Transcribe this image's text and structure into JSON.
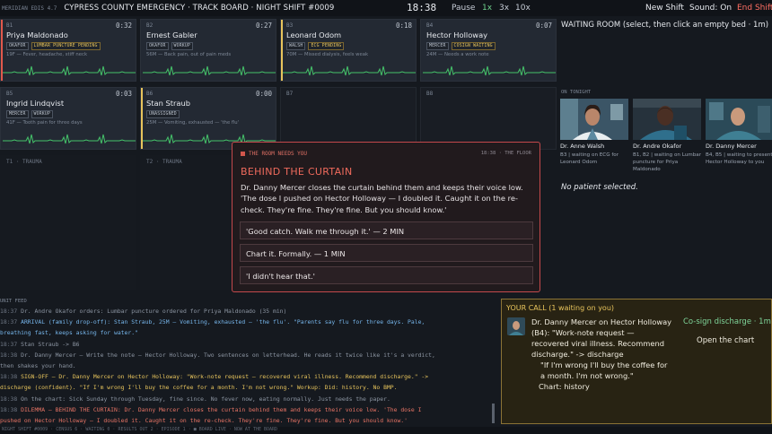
{
  "topbar": {
    "brand": "MERIDIAN EDIS 4.7",
    "hospital": "CYPRESS COUNTY EMERGENCY · TRACK BOARD · NIGHT SHIFT #0009",
    "clock": "18:38",
    "pause_label": "Pause",
    "speeds": [
      "1x",
      "3x",
      "10x"
    ],
    "new_shift_label": "New Shift",
    "sound_label": "Sound: On",
    "end_shift_label": "End Shift"
  },
  "beds": [
    {
      "id": "B1",
      "timer": "0:32",
      "name": "Priya Maldonado",
      "tags": [
        "OKAFOR",
        "LUMBAR PUNCTURE PENDING"
      ],
      "tag_warn": [
        false,
        true
      ],
      "cc": "19F — Fever, headache, stiff neck",
      "accent": "#e0584c"
    },
    {
      "id": "B2",
      "timer": "0:27",
      "name": "Ernest Gabler",
      "tags": [
        "OKAFOR",
        "WORKUP"
      ],
      "tag_warn": [
        false,
        false
      ],
      "cc": "56M — Back pain, out of pain meds",
      "accent": ""
    },
    {
      "id": "B3",
      "timer": "0:18",
      "name": "Leonard Odom",
      "tags": [
        "WALSH",
        "ECG PENDING"
      ],
      "tag_warn": [
        false,
        true
      ],
      "cc": "70M — Missed dialysis, feels weak",
      "accent": "#e8c45c"
    },
    {
      "id": "B4",
      "timer": "0:07",
      "name": "Hector Holloway",
      "tags": [
        "MERCER",
        "COSIGN WAITING"
      ],
      "tag_warn": [
        false,
        true
      ],
      "cc": "24M — Needs a work note",
      "accent": ""
    },
    {
      "id": "B5",
      "timer": "0:03",
      "name": "Ingrid Lindqvist",
      "tags": [
        "MERCER",
        "WORKUP"
      ],
      "tag_warn": [
        false,
        false
      ],
      "cc": "41F — Tooth pain for three days",
      "accent": ""
    },
    {
      "id": "B6",
      "timer": "0:00",
      "name": "Stan Straub",
      "tags": [
        "UNASSIGNED"
      ],
      "tag_warn": [
        false
      ],
      "cc": "25M — Vomiting, exhausted — 'the flu'",
      "accent": "#e8c45c"
    }
  ],
  "empty_beds": [
    "B7",
    "B8"
  ],
  "trauma_bays": [
    "T1 · TRAUMA",
    "T2 · TRAUMA"
  ],
  "waiting": {
    "title": "WAITING ROOM  (select, then click an empty bed · 1m)",
    "on_tonight_label": "ON TONIGHT",
    "no_patient": "No patient selected."
  },
  "doctors": [
    {
      "name": "Dr. Anne Walsh",
      "note": "B3 | waiting on ECG for Leonard Odom"
    },
    {
      "name": "Dr. Andre Okafor",
      "note": "B1, B2 | waiting on Lumbar puncture for Priya Maldonado"
    },
    {
      "name": "Dr. Danny Mercer",
      "note": "B4, B5 | waiting to present Hector Holloway to you"
    }
  ],
  "modal": {
    "kicker": "THE ROOM NEEDS YOU",
    "time": "18:38 · THE FLOOR",
    "title": "BEHIND THE CURTAIN",
    "body": "Dr. Danny Mercer closes the curtain behind them and keeps their voice low. 'The dose I pushed on Hector Holloway — I doubled it. Caught it on the re-check. They're fine. They're fine. But you should know.'",
    "choices": [
      "'Good catch. Walk me through it.'  — 2 MIN",
      "Chart it. Formally.  — 1 MIN",
      "'I didn't hear that.'"
    ]
  },
  "feed": {
    "label": "UNIT FEED",
    "lines": [
      {
        "time": "18:37",
        "kind": "dim",
        "text": "Dr. Andre Okafor orders: Lumbar puncture ordered for Priya Maldonado (35 min)"
      },
      {
        "time": "18:37",
        "kind": "arrival",
        "text": "ARRIVAL (family drop-off): Stan Straub, 25M — Vomiting, exhausted — 'the flu'. \"Parents say flu for three days. Pale,"
      },
      {
        "time": "",
        "kind": "arrival",
        "text": "breathing fast, keeps asking for water.\""
      },
      {
        "time": "18:37",
        "kind": "dim",
        "text": "Stan Straub -> B6"
      },
      {
        "time": "18:38",
        "kind": "dim",
        "text": "Dr. Danny Mercer — Write the note — Hector Holloway. Two sentences on letterhead. He reads it twice like it's a verdict,"
      },
      {
        "time": "",
        "kind": "dim",
        "text": "then shakes your hand."
      },
      {
        "time": "18:38",
        "kind": "signoff",
        "text": "SIGN-OFF — Dr. Danny Mercer on Hector Holloway: \"Work-note request — recovered viral illness. Recommend discharge.\" ->"
      },
      {
        "time": "",
        "kind": "signoff",
        "text": "discharge (confident). \"If I'm wrong I'll buy the coffee for a month. I'm not wrong.\" Workup: Did: history. No BMP."
      },
      {
        "time": "18:38",
        "kind": "dim",
        "text": "    On the chart: Sick Sunday through Tuesday, fine since. No fever now, eating normally. Just needs the paper."
      },
      {
        "time": "18:38",
        "kind": "dilemma",
        "text": "DILEMMA — BEHIND THE CURTAIN: Dr. Danny Mercer closes the curtain behind them and keeps their voice low. 'The dose I"
      },
      {
        "time": "",
        "kind": "dilemma",
        "text": "pushed on Hector Holloway — I doubled it. Caught it on the re-check. They're fine. They're fine. But you should know.'"
      }
    ]
  },
  "call": {
    "title": "YOUR CALL  (1 waiting on you)",
    "line1": "Dr. Danny Mercer on Hector Holloway",
    "line2": "(B4): \"Work-note request — recovered viral illness. Recommend discharge.\" -> discharge",
    "line3": "\"If I'm wrong I'll buy the coffee for a month. I'm not wrong.\"",
    "line4": "Chart: history",
    "cosign_label": "Co-sign discharge · 1m",
    "open_chart_label": "Open the chart"
  },
  "statusbar": {
    "text": "NIGHT SHIFT #0009  ·  CENSUS 6  ·  WAITING 0  ·  RESULTS OUT 2  ·  EPISODE 1  ·  ■ BOARD LIVE  ·  NOW AT THE BOARD"
  },
  "colors": {
    "accent_red": "#e0584c",
    "accent_yellow": "#e8c45c",
    "speed_active": "#6fd08c",
    "ecg_green": "#45c36a"
  }
}
